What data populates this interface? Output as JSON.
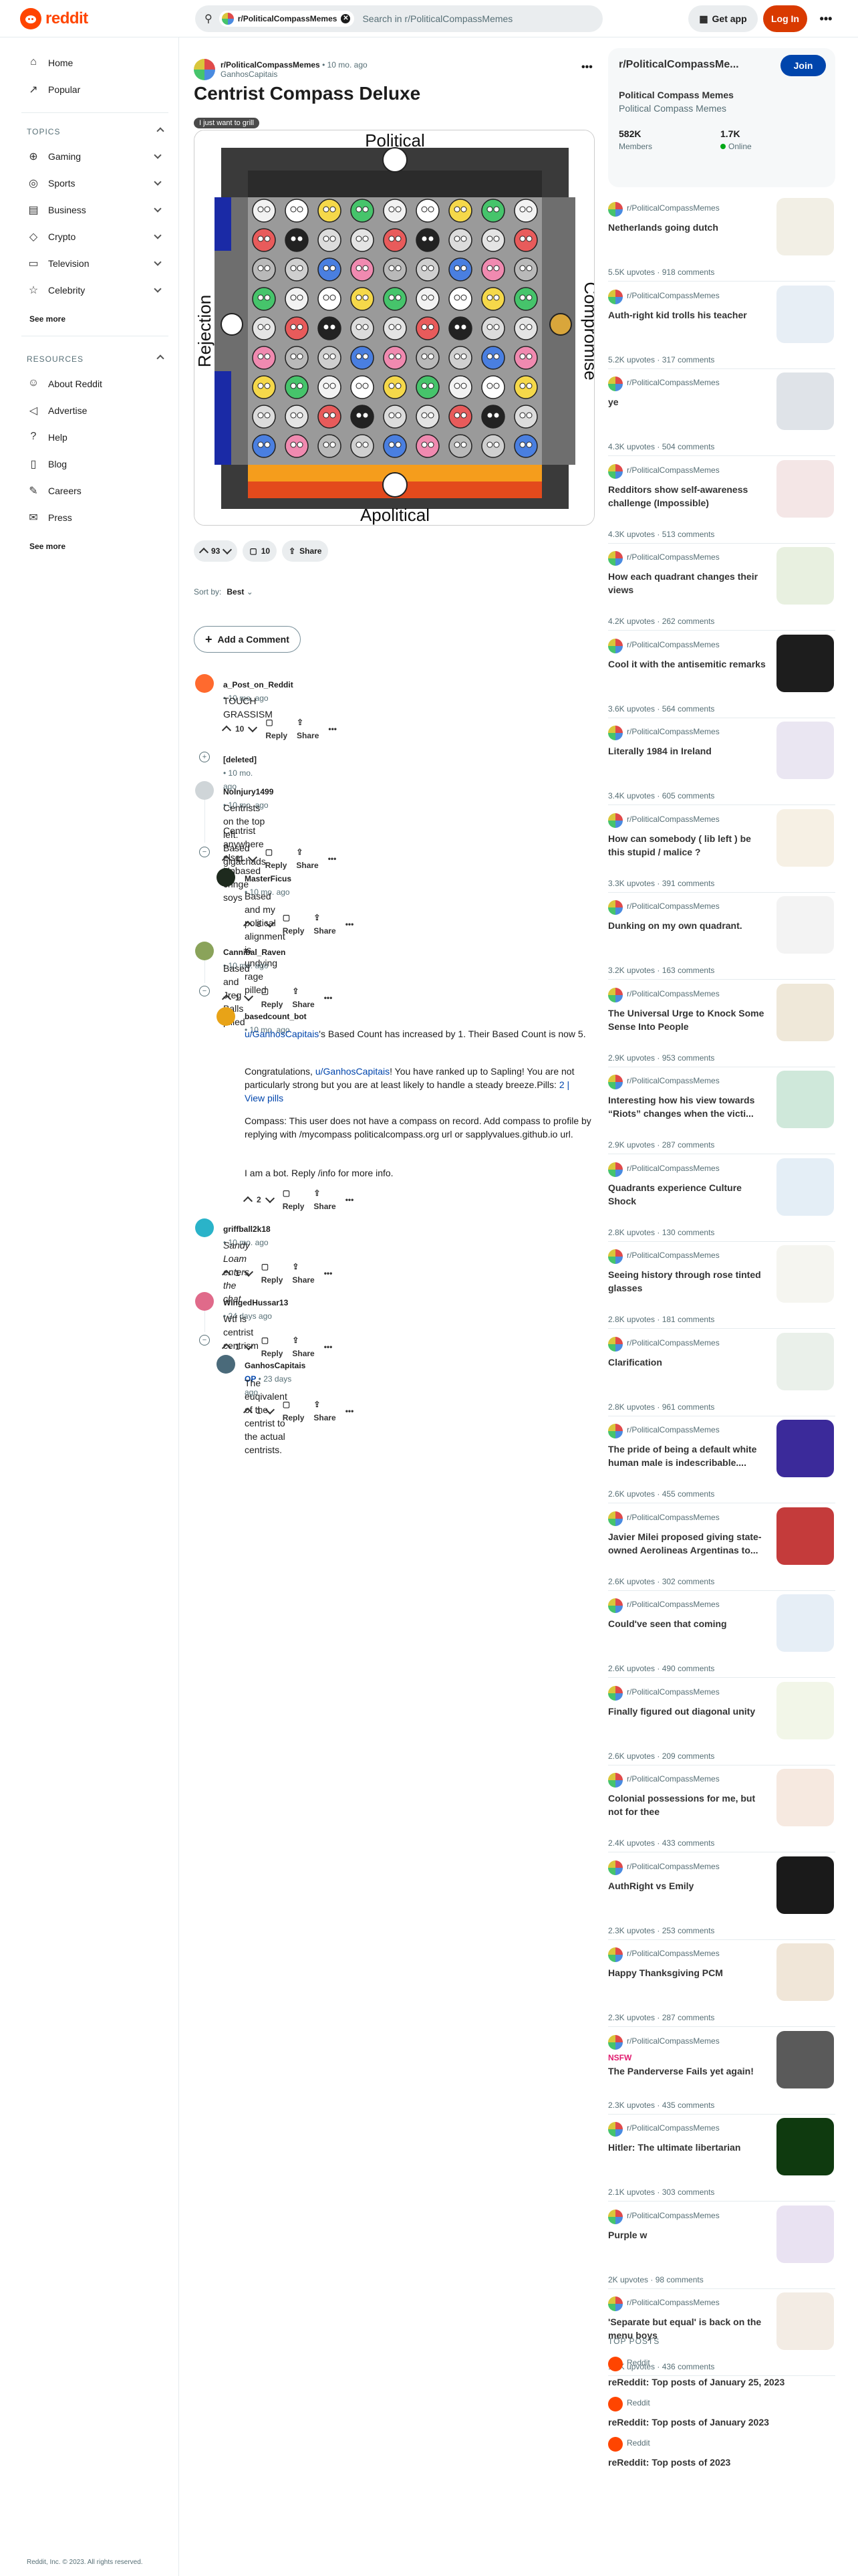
{
  "header": {
    "logo": "reddit",
    "search_chip": "r/PoliticalCompassMemes",
    "search_placeholder": "Search in r/PoliticalCompassMemes",
    "get_app": "Get app",
    "login": "Log In"
  },
  "sidebar": {
    "nav": [
      {
        "label": "Home",
        "icon": "home-icon"
      },
      {
        "label": "Popular",
        "icon": "popular-icon"
      }
    ],
    "topics_title": "TOPICS",
    "topics": [
      "Gaming",
      "Sports",
      "Business",
      "Crypto",
      "Television",
      "Celebrity"
    ],
    "see_more": "See more",
    "resources_title": "RESOURCES",
    "resources": [
      "About Reddit",
      "Advertise",
      "Help",
      "Blog",
      "Careers",
      "Press"
    ],
    "footer": "Reddit, Inc. © 2023. All rights reserved."
  },
  "post": {
    "subreddit": "r/PoliticalCompassMemes",
    "age": "10 mo. ago",
    "author": "GanhosCapitais",
    "title": "Centrist Compass Deluxe",
    "flair": "I just want to grill",
    "image_labels": {
      "top": "Political",
      "bottom": "Apolitical",
      "left": "Rejection",
      "right": "Compromise"
    },
    "score": "93",
    "comments": "10",
    "share": "Share",
    "sort_label": "Sort by:",
    "sort_value": "Best",
    "add_comment": "Add a Comment"
  },
  "comments": [
    {
      "author": "a_Post_on_Reddit",
      "age": "10 mo. ago",
      "text": "TOUCH GRASSISM",
      "score": "10"
    },
    {
      "author": "[deleted]",
      "age": "10 mo. ago"
    },
    {
      "author": "NoInjury1499",
      "age": "10 mo. ago",
      "text1": "Centrists on the top left: Based gigachads",
      "text2": "Centrist anywhere else: Unbased cringe soys",
      "score": "11"
    },
    {
      "author": "MasterFicus",
      "age": "10 mo. ago",
      "text": "Based and my political alignment is undying rage pilled",
      "score": "8"
    },
    {
      "author": "Cannibal_Raven",
      "age": "10 mo. ago",
      "text": "Based and Jreg Balls pilled",
      "score": "1"
    },
    {
      "author": "basedcount_bot",
      "age": "10 mo. ago",
      "l1a": "u/GanhosCapitais",
      "l1b": "'s Based Count has increased by 1. Their Based Count is now 5.",
      "l2a": "Congratulations, ",
      "l2b": "u/GanhosCapitais",
      "l2c": "! You have ranked up to Sapling! You are not particularly strong but you are at least likely to handle a steady breeze.Pills: ",
      "l2d": "2 | View pills",
      "l3": "Compass: This user does not have a compass on record. Add compass to profile by replying with /mycompass politicalcompass.org url or sapplyvalues.github.io url.",
      "l4": "I am a bot. Reply /info for more info.",
      "score": "2"
    },
    {
      "author": "griffball2k18",
      "age": "10 mo. ago",
      "text": "Sandy Loam enters the chat",
      "score": "1"
    },
    {
      "author": "WingedHussar13",
      "age": "24 days ago",
      "text": "Wtf is centrist centrism",
      "score": "1"
    },
    {
      "author": "GanhosCapitais",
      "op": "OP",
      "age": "23 days ago",
      "text": "The euqivalent of the centrist to the actual centrists.",
      "score": "1"
    }
  ],
  "actions": {
    "reply": "Reply",
    "share": "Share"
  },
  "community": {
    "name": "r/PoliticalCompassMe...",
    "title": "Political Compass Memes",
    "subtitle": "Political Compass Memes",
    "join": "Join",
    "members": "582K",
    "members_label": "Members",
    "online": "1.7K",
    "online_label": "Online"
  },
  "related": [
    {
      "sub": "r/PoliticalCompassMemes",
      "title": "Netherlands going dutch",
      "stats": "5.5K upvotes · 918 comments"
    },
    {
      "sub": "r/PoliticalCompassMemes",
      "title": "Auth-right kid trolls his teacher",
      "stats": "5.2K upvotes · 317 comments"
    },
    {
      "sub": "r/PoliticalCompassMemes",
      "title": "ye",
      "stats": "4.3K upvotes · 504 comments"
    },
    {
      "sub": "r/PoliticalCompassMemes",
      "title": "Redditors show self-awareness challenge (Impossible)",
      "stats": "4.3K upvotes · 513 comments"
    },
    {
      "sub": "r/PoliticalCompassMemes",
      "title": "How each quadrant changes their views",
      "stats": "4.2K upvotes · 262 comments"
    },
    {
      "sub": "r/PoliticalCompassMemes",
      "title": "Cool it with the antisemitic remarks",
      "stats": "3.6K upvotes · 564 comments"
    },
    {
      "sub": "r/PoliticalCompassMemes",
      "title": "Literally 1984 in Ireland",
      "stats": "3.4K upvotes · 605 comments"
    },
    {
      "sub": "r/PoliticalCompassMemes",
      "title": "How can somebody ( lib left ) be this stupid / malice ?",
      "stats": "3.3K upvotes · 391 comments"
    },
    {
      "sub": "r/PoliticalCompassMemes",
      "title": "Dunking on my own quadrant.",
      "stats": "3.2K upvotes · 163 comments"
    },
    {
      "sub": "r/PoliticalCompassMemes",
      "title": "The Universal Urge to Knock Some Sense Into People",
      "stats": "2.9K upvotes · 953 comments"
    },
    {
      "sub": "r/PoliticalCompassMemes",
      "title": "Interesting how his view towards “Riots” changes when the victi...",
      "stats": "2.9K upvotes · 287 comments"
    },
    {
      "sub": "r/PoliticalCompassMemes",
      "title": "Quadrants experience Culture Shock",
      "stats": "2.8K upvotes · 130 comments"
    },
    {
      "sub": "r/PoliticalCompassMemes",
      "title": "Seeing history through rose tinted glasses",
      "stats": "2.8K upvotes · 181 comments"
    },
    {
      "sub": "r/PoliticalCompassMemes",
      "title": "Clarification",
      "stats": "2.8K upvotes · 961 comments"
    },
    {
      "sub": "r/PoliticalCompassMemes",
      "title": "The pride of being a default white human male is indescribable....",
      "stats": "2.6K upvotes · 455 comments"
    },
    {
      "sub": "r/PoliticalCompassMemes",
      "title": "Javier Milei proposed giving state-owned Aerolineas Argentinas to...",
      "stats": "2.6K upvotes · 302 comments"
    },
    {
      "sub": "r/PoliticalCompassMemes",
      "title": "Could've seen that coming",
      "stats": "2.6K upvotes · 490 comments"
    },
    {
      "sub": "r/PoliticalCompassMemes",
      "title": "Finally figured out diagonal unity",
      "stats": "2.6K upvotes · 209 comments"
    },
    {
      "sub": "r/PoliticalCompassMemes",
      "title": "Colonial possessions for me, but not for thee",
      "stats": "2.4K upvotes · 433 comments"
    },
    {
      "sub": "r/PoliticalCompassMemes",
      "title": "AuthRight vs Emily",
      "stats": "2.3K upvotes · 253 comments"
    },
    {
      "sub": "r/PoliticalCompassMemes",
      "title": "Happy Thanksgiving PCM",
      "stats": "2.3K upvotes · 287 comments"
    },
    {
      "sub": "r/PoliticalCompassMemes",
      "title": "The Panderverse Fails yet again!",
      "stats": "2.3K upvotes · 435 comments",
      "nsfw": "NSFW"
    },
    {
      "sub": "r/PoliticalCompassMemes",
      "title": "Hitler: The ultimate libertarian",
      "stats": "2.1K upvotes · 303 comments"
    },
    {
      "sub": "r/PoliticalCompassMemes",
      "title": "Purple w",
      "stats": "2K upvotes · 98 comments"
    },
    {
      "sub": "r/PoliticalCompassMemes",
      "title": "'Separate but equal' is back on the menu boys",
      "stats": "1.9K upvotes · 436 comments"
    }
  ],
  "top_posts": {
    "title": "TOP POSTS",
    "items": [
      {
        "sub": "Reddit",
        "title": "reReddit: Top posts of January 25, 2023"
      },
      {
        "sub": "Reddit",
        "title": "reReddit: Top posts of January 2023"
      },
      {
        "sub": "Reddit",
        "title": "reReddit: Top posts of 2023"
      }
    ]
  }
}
